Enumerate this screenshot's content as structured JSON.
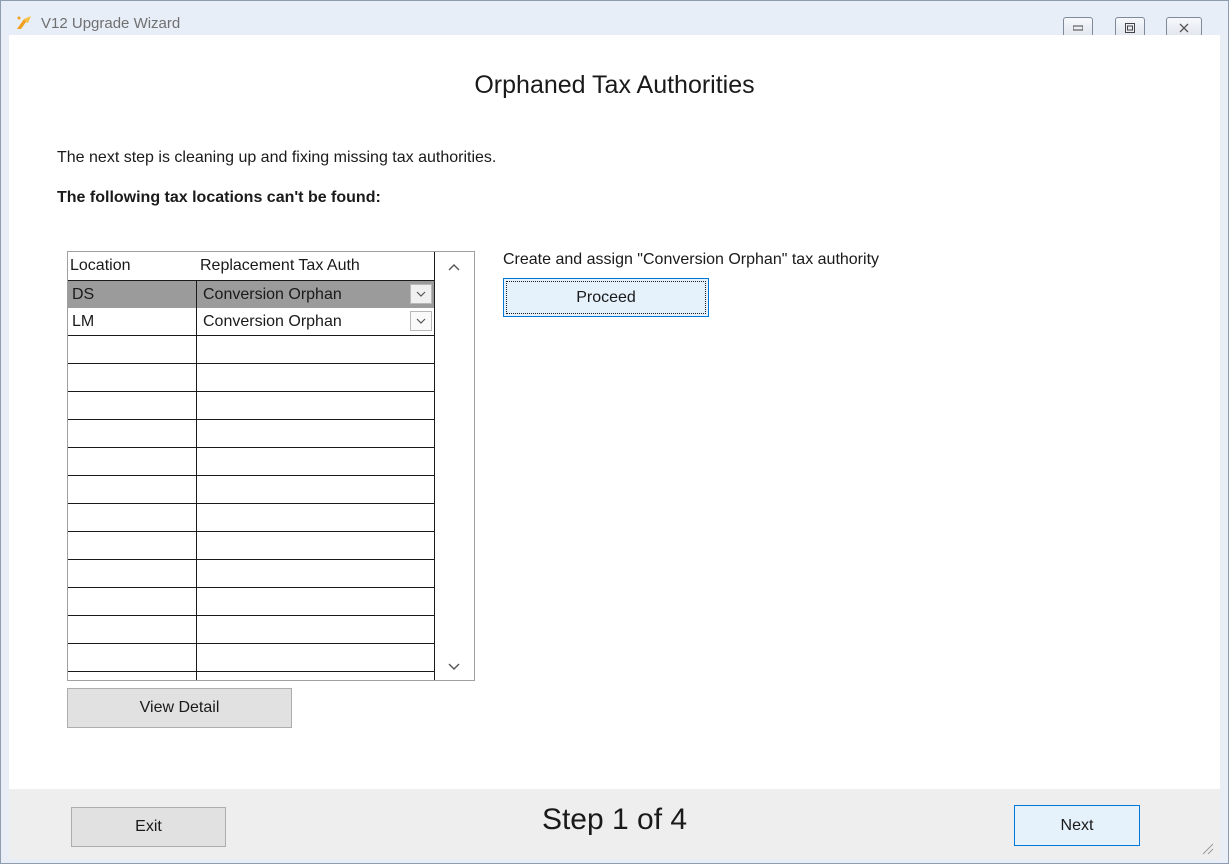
{
  "window": {
    "title": "V12 Upgrade Wizard"
  },
  "page": {
    "heading": "Orphaned Tax Authorities",
    "intro": "The next step is cleaning up and fixing missing tax authorities.",
    "subheading": "The following tax locations can't be found:"
  },
  "grid": {
    "columns": [
      "Location",
      "Replacement Tax Auth"
    ],
    "rows": [
      {
        "location": "DS",
        "replacement": "Conversion Orphan",
        "selected": true
      },
      {
        "location": "LM",
        "replacement": "Conversion Orphan",
        "selected": false
      }
    ]
  },
  "actions": {
    "view_detail_label": "View Detail",
    "create_label": "Create and assign \"Conversion Orphan\" tax authority",
    "proceed_label": "Proceed"
  },
  "footer": {
    "exit_label": "Exit",
    "step_text": "Step 1 of 4",
    "next_label": "Next"
  },
  "icons": {
    "app": "wizard-icon",
    "minimize": "minimize-icon",
    "restore": "restore-icon",
    "close": "close-icon",
    "dropdown": "chevron-down-icon",
    "scroll_up": "chevron-up-icon",
    "scroll_down": "chevron-down-icon",
    "resize": "resize-grip-icon"
  },
  "colors": {
    "selected_row": "#9b9b9b",
    "accent_border": "#0078d7"
  }
}
